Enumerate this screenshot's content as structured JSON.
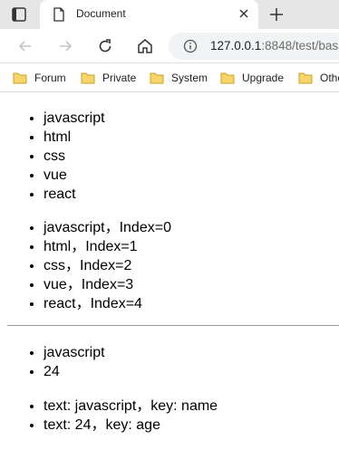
{
  "browser": {
    "tab_title": "Document",
    "url_host": "127.0.0.1",
    "url_rest": ":8848/test/bas",
    "bookmarks": [
      {
        "label": "Forum"
      },
      {
        "label": "Private"
      },
      {
        "label": "System"
      },
      {
        "label": "Upgrade"
      },
      {
        "label": "Othe"
      }
    ],
    "icons": [
      "tab-actions-icon",
      "document-icon",
      "close-icon",
      "new-tab-icon",
      "back-icon",
      "forward-icon",
      "reload-icon",
      "home-icon",
      "info-icon",
      "folder-icon"
    ]
  },
  "page": {
    "list1": [
      "javascript",
      "html",
      "css",
      "vue",
      "react"
    ],
    "list2": [
      "javascript，Index=0",
      "html，Index=1",
      "css，Index=2",
      "vue，Index=3",
      "react，Index=4"
    ],
    "list3": [
      "javascript",
      "24"
    ],
    "list4": [
      "text: javascript，key: name",
      "text: 24，key: age"
    ]
  }
}
